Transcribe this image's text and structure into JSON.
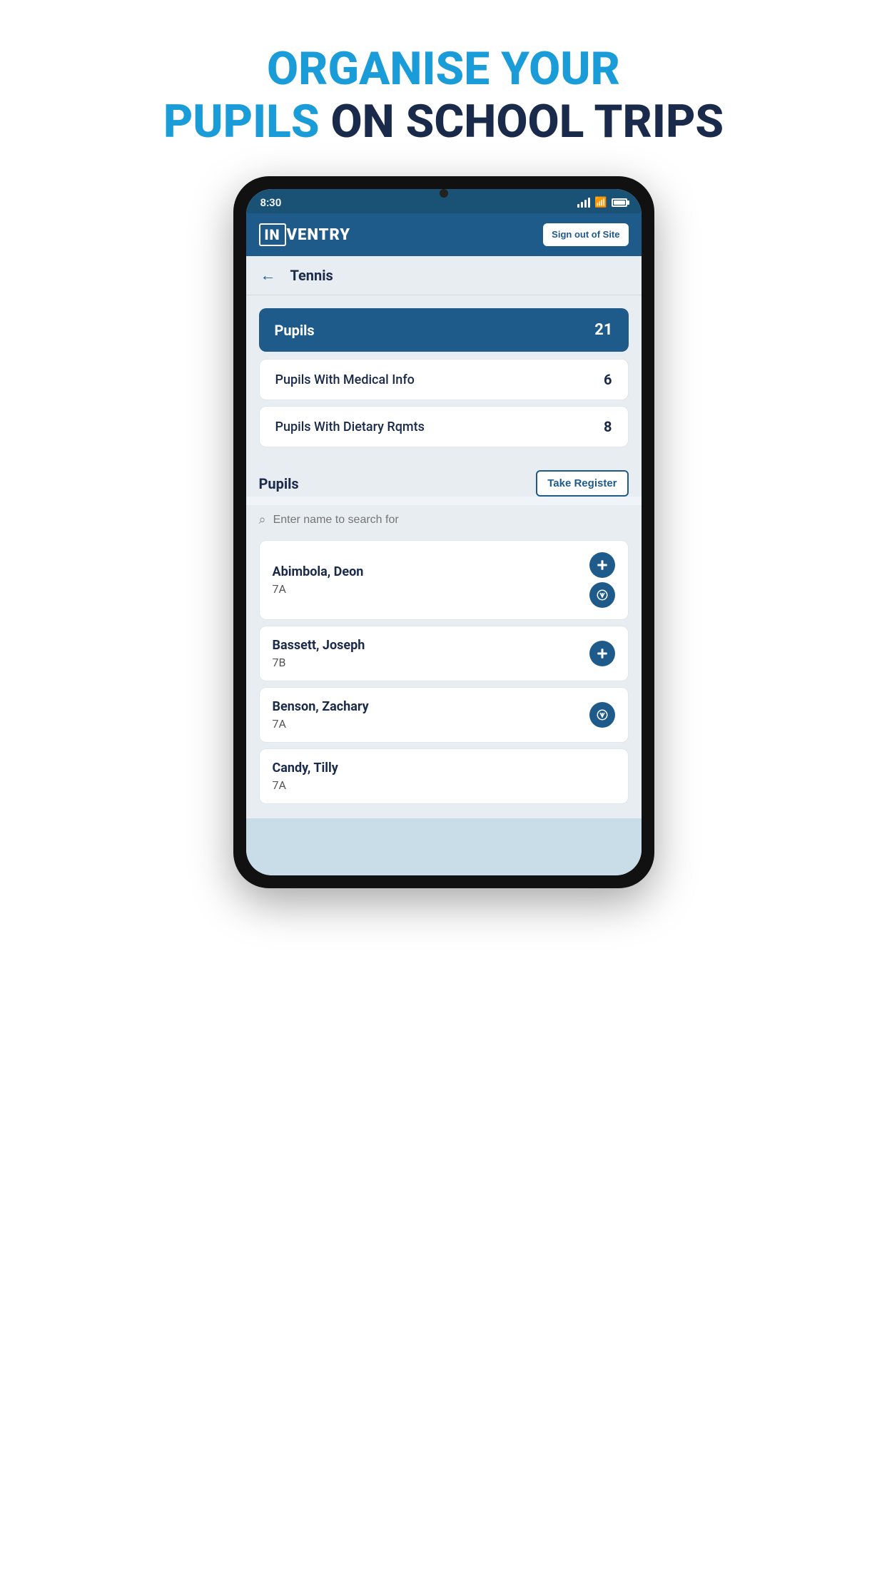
{
  "pageHeader": {
    "line1": "ORGANISE YOUR",
    "line2": "PUPILS ON SCHOOL TRIPS"
  },
  "statusBar": {
    "time": "8:30"
  },
  "appHeader": {
    "logoText": "INVENTRY",
    "signOutLabel": "Sign out\nof Site"
  },
  "navBar": {
    "title": "Tennis",
    "backArrow": "←"
  },
  "stats": [
    {
      "label": "Pupils",
      "count": "21",
      "primary": true
    },
    {
      "label": "Pupils With Medical Info",
      "count": "6",
      "primary": false
    },
    {
      "label": "Pupils With Dietary Rqmts",
      "count": "8",
      "primary": false
    }
  ],
  "pupilsSection": {
    "title": "Pupils",
    "takeRegisterLabel": "Take Register",
    "searchPlaceholder": "Enter name to search for"
  },
  "pupils": [
    {
      "name": "Abimbola, Deon",
      "class": "7A",
      "hasMedical": true,
      "hasDietary": true
    },
    {
      "name": "Bassett, Joseph",
      "class": "7B",
      "hasMedical": true,
      "hasDietary": false
    },
    {
      "name": "Benson, Zachary",
      "class": "7A",
      "hasMedical": false,
      "hasDietary": true
    },
    {
      "name": "Candy, Tilly",
      "class": "7A",
      "hasMedical": false,
      "hasDietary": false
    }
  ],
  "icons": {
    "medical": "➕",
    "dietary": "🍽",
    "back": "←",
    "search": "🔍"
  }
}
